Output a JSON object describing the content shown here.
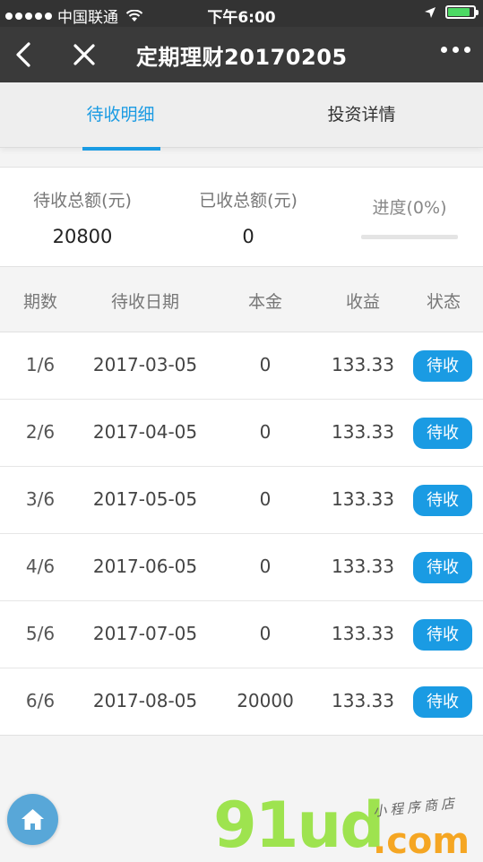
{
  "status_bar": {
    "carrier": "中国联通",
    "time": "下午6:00"
  },
  "nav": {
    "title": "定期理财20170205"
  },
  "tabs": [
    {
      "label": "待收明细",
      "active": true
    },
    {
      "label": "投资详情",
      "active": false
    }
  ],
  "summary": {
    "pending_label": "待收总额(元)",
    "pending_value": "20800",
    "received_label": "已收总额(元)",
    "received_value": "0",
    "progress_label": "进度(0%)",
    "progress_fraction": 0
  },
  "table": {
    "headers": [
      "期数",
      "待收日期",
      "本金",
      "收益",
      "状态"
    ],
    "rows": [
      {
        "period": "1/6",
        "date": "2017-03-05",
        "principal": "0",
        "income": "133.33",
        "status": "待收"
      },
      {
        "period": "2/6",
        "date": "2017-04-05",
        "principal": "0",
        "income": "133.33",
        "status": "待收"
      },
      {
        "period": "3/6",
        "date": "2017-05-05",
        "principal": "0",
        "income": "133.33",
        "status": "待收"
      },
      {
        "period": "4/6",
        "date": "2017-06-05",
        "principal": "0",
        "income": "133.33",
        "status": "待收"
      },
      {
        "period": "5/6",
        "date": "2017-07-05",
        "principal": "0",
        "income": "133.33",
        "status": "待收"
      },
      {
        "period": "6/6",
        "date": "2017-08-05",
        "principal": "20000",
        "income": "133.33",
        "status": "待收"
      }
    ]
  },
  "watermark": {
    "logo": "91ud",
    "domain": ".com",
    "tagline": "小程序商店"
  },
  "colors": {
    "accent": "#1a9be3",
    "nav_bg": "#3a3a3a",
    "status_bg": "#333333",
    "battery": "#4cd964"
  },
  "icons": [
    "signal-dots-icon",
    "wifi-icon",
    "location-arrow-icon",
    "battery-icon",
    "back-chevron-icon",
    "close-icon",
    "more-dots-icon",
    "home-icon"
  ]
}
